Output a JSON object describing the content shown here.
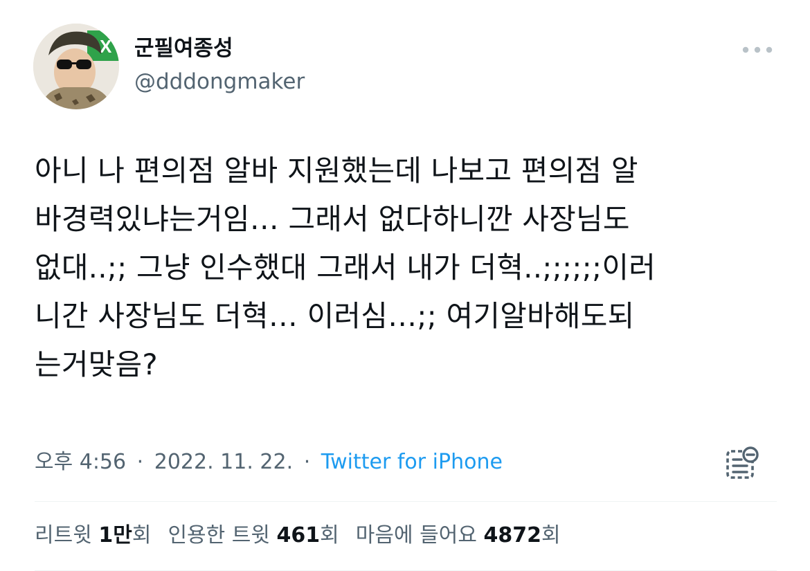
{
  "user": {
    "display_name": "군필여종성",
    "handle": "@dddongmaker",
    "avatar_badge": "X"
  },
  "tweet": {
    "text": "아니 나 편의점 알바 지원했는데 나보고 편의점 알\n바경력있냐는거임… 그래서 없다하니깐 사장님도\n없대..;; 그냥 인수했대 그래서 내가 더혁..;;;;;;이러\n니간 사장님도 더혁… 이러심…;; 여기알바해도되\n는거맞음?"
  },
  "meta": {
    "time": "오후 4:56",
    "separator": "·",
    "date": "2022. 11. 22.",
    "source": "Twitter for iPhone"
  },
  "stats": {
    "retweets_label": "리트윗",
    "retweets_num": "1만",
    "retweets_unit": "회",
    "quotes_label": "인용한 트윗",
    "quotes_num": "461",
    "quotes_unit": "회",
    "likes_label": "마음에 들어요",
    "likes_num": "4872",
    "likes_unit": "회"
  },
  "colors": {
    "text": "#0f1419",
    "secondary": "#536471",
    "link": "#1d9bf0",
    "divider": "#eff3f4"
  },
  "icons": {
    "more": "more-horizontal-icon",
    "notes": "community-notes-icon"
  }
}
